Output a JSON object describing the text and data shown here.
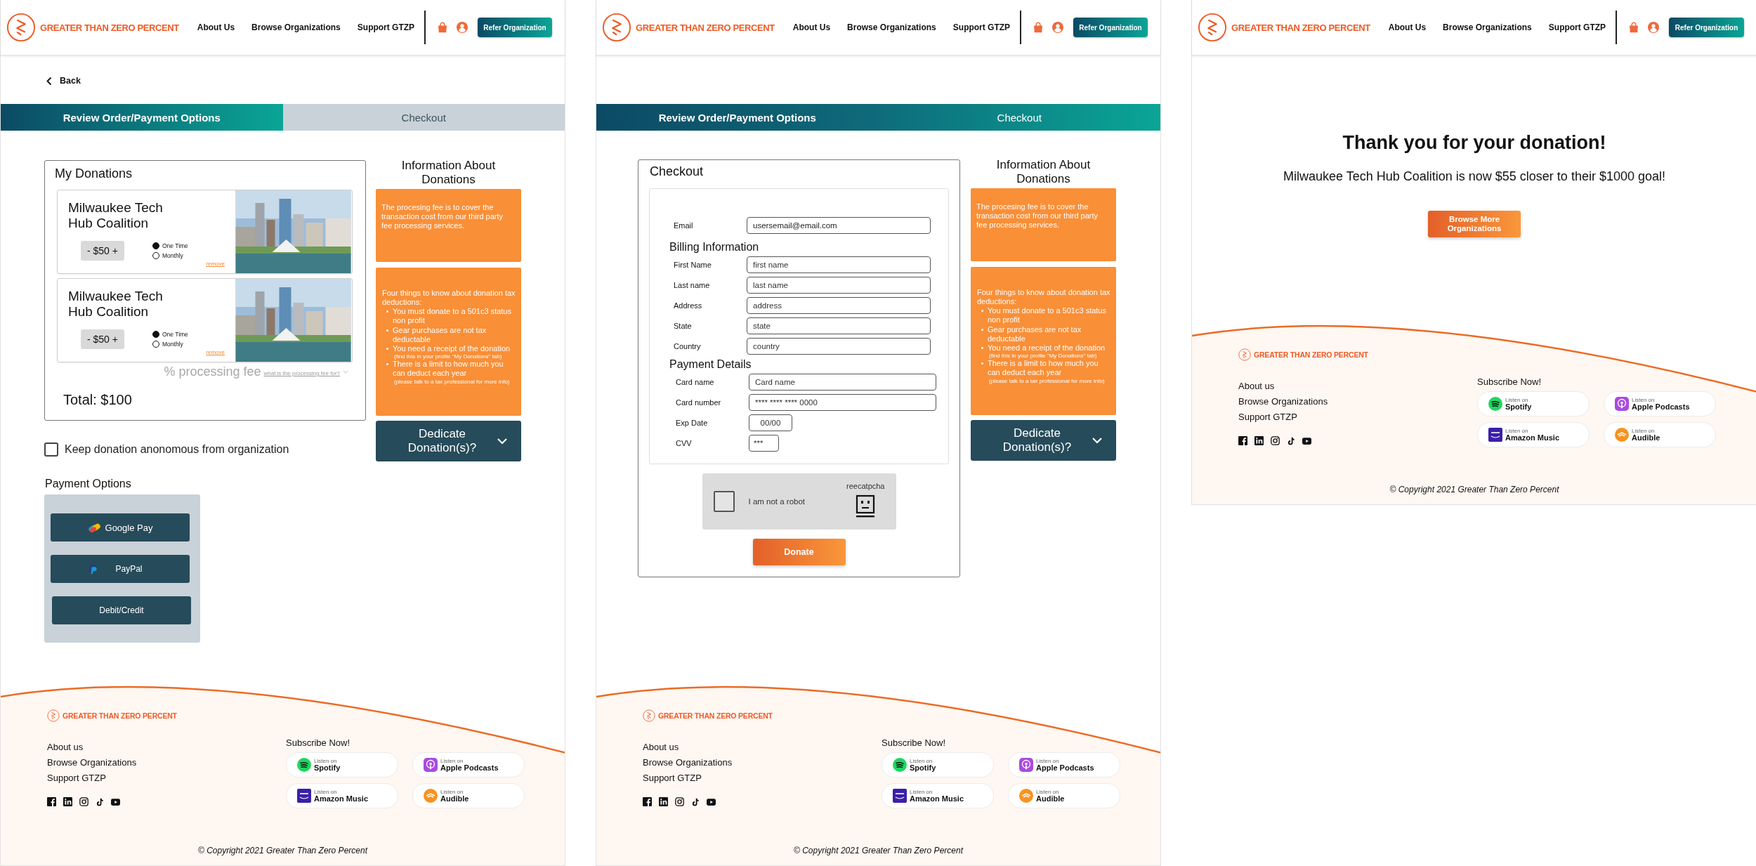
{
  "pages": [
    {
      "kind": "review",
      "header": {
        "logo": "GREATER THAN ZERO PERCENT",
        "nav": [
          "About Us",
          "Browse Organizations",
          "Support GTZP"
        ],
        "button": "Refer Organization"
      },
      "back": "Back",
      "tabs": [
        {
          "label": "Review Order/Payment Options",
          "selected": true,
          "completed": false
        },
        {
          "label": "Checkout",
          "selected": false,
          "completed": false
        }
      ],
      "donations": {
        "title": "My Donations",
        "items": [
          {
            "name": "Milwaukee Tech Hub Coalition",
            "amount": "- $50 +",
            "frequencies": [
              {
                "label": "One Time",
                "selected": true
              },
              {
                "label": "Monthly",
                "selected": false
              }
            ],
            "remove": "remove",
            "image": {
              "kind": "picture"
            }
          },
          {
            "name": "Milwaukee Tech Hub Coalition",
            "amount": "- $50 +",
            "frequencies": [
              {
                "label": "One Time",
                "selected": true
              },
              {
                "label": "Monthly",
                "selected": false
              }
            ],
            "remove": "remove",
            "image": {
              "kind": "picture"
            }
          }
        ],
        "fee": "% processing fee",
        "fee_link": "what is the processing fee for?",
        "total": "Total: $100"
      },
      "anonymous": {
        "label": "Keep donation anonomous from organization",
        "checked": false
      },
      "payment": {
        "title": "Payment Options",
        "buttons": [
          {
            "label": "Google Pay",
            "kind": "gpay"
          },
          {
            "label": "PayPal",
            "kind": "paypal"
          },
          {
            "label": "Debit/Credit",
            "kind": "card"
          }
        ]
      },
      "info": {
        "title": "Information About Donations",
        "fee_note": "The procesing fee is to cover the transaction cost from our third party fee processing services.",
        "tax_intro": "Four things to know about donation tax deductions:",
        "points": [
          {
            "text": "You must donate to a 501c3 status non profit"
          },
          {
            "text": "Gear purchases are not tax deductable"
          },
          {
            "text": "You need a receipt of the donation",
            "note": "(find this in your profile \"My Donations\" tab)"
          },
          {
            "text": "There is a limit to how much you can deduct each year",
            "note": "(please talk to a tax professional for more info)"
          }
        ],
        "dedicate": "Dedicate Donation(s)?"
      },
      "footer": {
        "logo": "GREATER THAN ZERO PERCENT",
        "links": [
          "About us",
          "Browse Organizations",
          "Support GTZP"
        ],
        "subscribe": "Subscribe Now!",
        "badges": [
          {
            "kind": "spotify",
            "caption": "Listen on",
            "name": "Spotify"
          },
          {
            "kind": "apple",
            "caption": "Listen on",
            "name": "Apple Podcasts"
          },
          {
            "kind": "amazon",
            "caption": "Listen on",
            "name": "Amazon Music"
          },
          {
            "kind": "audible",
            "caption": "Listen on",
            "name": "Audible"
          }
        ],
        "copyright": "© Copyright 2021 Greater Than Zero Percent"
      }
    },
    {
      "kind": "checkout",
      "header": {
        "logo": "GREATER THAN ZERO PERCENT",
        "nav": [
          "About Us",
          "Browse Organizations",
          "Support GTZP"
        ],
        "button": "Refer Organization"
      },
      "tabs": [
        {
          "label": "Review Order/Payment Options",
          "selected": false,
          "completed": true
        },
        {
          "label": "Checkout",
          "selected": true,
          "completed": false
        }
      ],
      "checkout": {
        "title": "Checkout",
        "email": {
          "label": "Email",
          "value": "usersemail@email.com"
        },
        "billing_title": "Billing Information",
        "billing": [
          {
            "label": "First Name",
            "placeholder": "first name"
          },
          {
            "label": "Last name",
            "placeholder": "last name"
          },
          {
            "label": "Address",
            "placeholder": "address"
          },
          {
            "label": "State",
            "placeholder": "state"
          },
          {
            "label": "Country",
            "placeholder": "country"
          }
        ],
        "payment_title": "Payment Details",
        "payment": [
          {
            "label": "Card name",
            "placeholder": "Card name",
            "kind": "wide"
          },
          {
            "label": "Card number",
            "placeholder": "**** **** **** 0000",
            "kind": "wide"
          },
          {
            "label": "Exp Date",
            "placeholder": "00/00",
            "kind": "short"
          },
          {
            "label": "CVV",
            "placeholder": "***",
            "kind": "tiny"
          }
        ],
        "captcha": {
          "label": "I am not a robot",
          "brand": "reecatpcha",
          "checked": false
        },
        "donate": "Donate"
      },
      "info": {
        "title": "Information About Donations",
        "fee_note": "The procesing fee is to cover the transaction cost from our third party fee processing services.",
        "tax_intro": "Four things to know about donation tax deductions:",
        "points": [
          {
            "text": "You must donate to a 501c3 status non profit"
          },
          {
            "text": "Gear purchases are not tax deductable"
          },
          {
            "text": "You need a receipt of the donation",
            "note": "(find this in your profile \"My Donations\" tab)"
          },
          {
            "text": "There is a limit to how much you can deduct each year",
            "note": "(please talk to a tax professional for more info)"
          }
        ],
        "dedicate": "Dedicate Donation(s)?"
      },
      "footer": {
        "logo": "GREATER THAN ZERO PERCENT",
        "links": [
          "About us",
          "Browse Organizations",
          "Support GTZP"
        ],
        "subscribe": "Subscribe Now!",
        "badges": [
          {
            "kind": "spotify",
            "caption": "Listen on",
            "name": "Spotify"
          },
          {
            "kind": "apple",
            "caption": "Listen on",
            "name": "Apple Podcasts"
          },
          {
            "kind": "amazon",
            "caption": "Listen on",
            "name": "Amazon Music"
          },
          {
            "kind": "audible",
            "caption": "Listen on",
            "name": "Audible"
          }
        ],
        "copyright": "© Copyright 2021 Greater Than Zero Percent"
      }
    },
    {
      "kind": "thanks",
      "header": {
        "logo": "GREATER THAN ZERO PERCENT",
        "nav": [
          "About Us",
          "Browse Organizations",
          "Support GTZP"
        ],
        "button": "Refer Organization"
      },
      "thanks": {
        "title": "Thank you for your donation!",
        "message": "Milwaukee Tech Hub Coalition is now $55 closer to their $1000 goal!",
        "button": "Browse More Organizations"
      },
      "footer": {
        "logo": "GREATER THAN ZERO PERCENT",
        "links": [
          "About us",
          "Browse Organizations",
          "Support GTZP"
        ],
        "subscribe": "Subscribe Now!",
        "badges": [
          {
            "kind": "spotify",
            "caption": "Listen on",
            "name": "Spotify"
          },
          {
            "kind": "apple",
            "caption": "Listen on",
            "name": "Apple Podcasts"
          },
          {
            "kind": "amazon",
            "caption": "Listen on",
            "name": "Amazon Music"
          },
          {
            "kind": "audible",
            "caption": "Listen on",
            "name": "Audible"
          }
        ],
        "copyright": "© Copyright 2021 Greater Than Zero Percent"
      }
    }
  ]
}
